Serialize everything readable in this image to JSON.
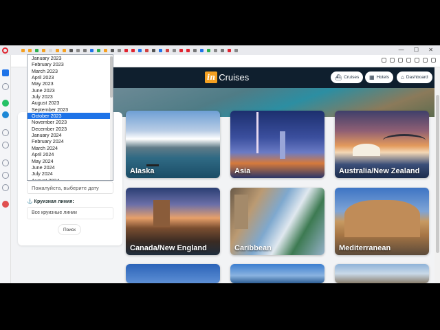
{
  "browser": {
    "tab_colors": [
      "#f4a021",
      "#f4a021",
      "#2bb04f",
      "#f4a021",
      "#d8d8d8",
      "#f4a021",
      "#f4a021",
      "#555",
      "#888",
      "#777",
      "#1e73e8",
      "#2bb04f",
      "#f4a021",
      "#555",
      "#888",
      "#e0232f",
      "#e0232f",
      "#1e73e8",
      "#d04040",
      "#555",
      "#1e73e8",
      "#d04040",
      "#888",
      "#e0232f",
      "#e0232f",
      "#777",
      "#1e73e8",
      "#2bb04f",
      "#888",
      "#777",
      "#e0232f",
      "#888"
    ],
    "window_controls": "— ☐ ✕"
  },
  "header": {
    "logo_in": "in",
    "logo_text": "Cruises",
    "nav": [
      {
        "label": "Cruises",
        "icon": "ship-icon"
      },
      {
        "label": "Hotels",
        "icon": "hotel-icon"
      },
      {
        "label": "Dashboard",
        "icon": "home-icon"
      }
    ]
  },
  "search": {
    "date_placeholder": "Пожалуйста, выберите дату",
    "line_label": "Круизная линия:",
    "line_value": "Все круизные линии",
    "button": "Поиск"
  },
  "dropdown": {
    "options": [
      "January 2023",
      "February 2023",
      "March 2023",
      "April 2023",
      "May 2023",
      "June 2023",
      "July 2023",
      "August 2023",
      "September 2023",
      "October 2023",
      "November 2023",
      "December 2023",
      "January 2024",
      "February 2024",
      "March 2024",
      "April 2024",
      "May 2024",
      "June 2024",
      "July 2024",
      "August 2024"
    ],
    "selected": "October 2023"
  },
  "destinations": [
    "Alaska",
    "Asia",
    "Australia/New Zealand",
    "Canada/New England",
    "Caribbean",
    "Mediterranean"
  ]
}
